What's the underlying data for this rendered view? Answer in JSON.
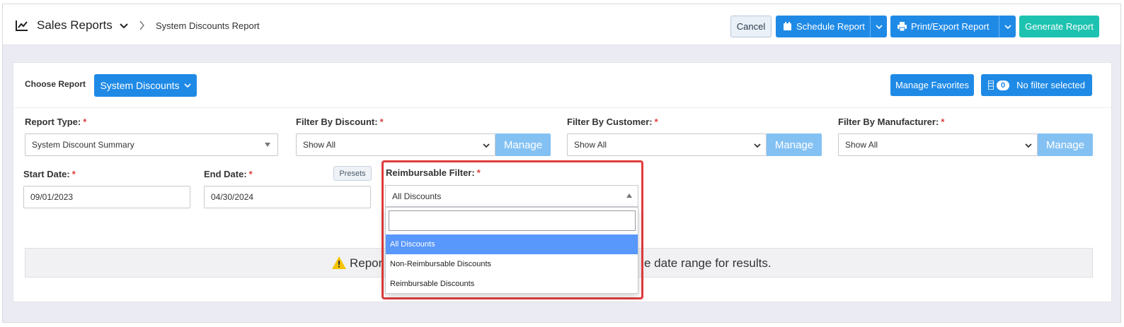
{
  "header": {
    "title": "Sales Reports",
    "breadcrumb": "System Discounts Report",
    "cancel_label": "Cancel",
    "schedule_label": "Schedule Report",
    "print_label": "Print/Export Report",
    "generate_label": "Generate Report"
  },
  "choose": {
    "label": "Choose Report",
    "selected": "System Discounts",
    "manage_favorites": "Manage Favorites",
    "filter_count": "0",
    "filter_text": "No filter selected"
  },
  "filters": {
    "report_type": {
      "label": "Report Type:",
      "value": "System Discount Summary"
    },
    "discount": {
      "label": "Filter By Discount:",
      "value": "Show All",
      "manage": "Manage"
    },
    "customer": {
      "label": "Filter By Customer:",
      "value": "Show All",
      "manage": "Manage"
    },
    "manufacturer": {
      "label": "Filter By Manufacturer:",
      "value": "Show All",
      "manage": "Manage"
    },
    "required_mark": "*"
  },
  "dates": {
    "start_label": "Start Date:",
    "start_value": "09/01/2023",
    "end_label": "End Date:",
    "end_value": "04/30/2024",
    "presets_label": "Presets"
  },
  "reimbursable": {
    "label": "Reimbursable Filter:",
    "selected": "All Discounts",
    "search_value": "",
    "options": [
      "All Discounts",
      "Non-Reimbursable Discounts",
      "Reimbursable Discounts"
    ]
  },
  "alert": {
    "text_left": "Repor",
    "text_right": "e date range for results."
  },
  "colors": {
    "primary": "#1f8ae6",
    "teal": "#1ec2b0",
    "manage_light": "#84c1f3",
    "highlight": "#e03c3c",
    "selected_option": "#5897fb"
  }
}
